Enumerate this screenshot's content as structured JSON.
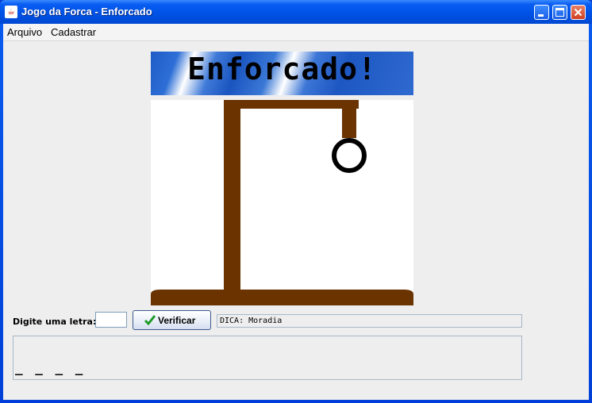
{
  "window": {
    "title": "Jogo da Forca - Enforcado",
    "icon": "java-cup-icon"
  },
  "menubar": {
    "items": [
      {
        "label": "Arquivo"
      },
      {
        "label": "Cadastrar"
      }
    ]
  },
  "banner": {
    "text": "Enforcado!"
  },
  "gallows": {
    "wood_color": "#6b3300",
    "noose_color": "#000000"
  },
  "controls": {
    "letter_label": "Digite uma letra:",
    "letter_value": "",
    "verify_label": "Verificar",
    "verify_icon": "checkmark-icon",
    "hint_text": "DICA: Moradia"
  },
  "word": {
    "display": "_ _ _ _"
  }
}
